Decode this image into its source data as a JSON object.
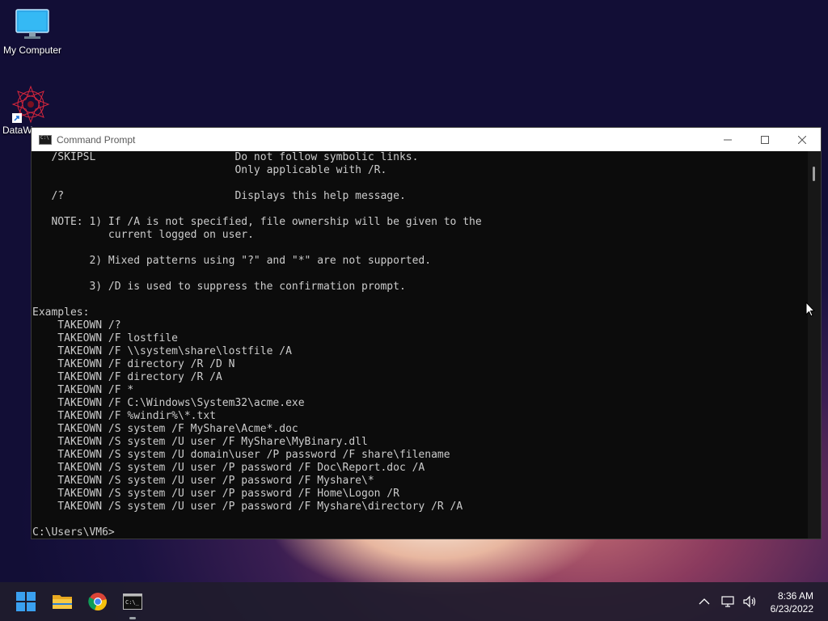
{
  "desktop": {
    "icons": [
      {
        "label": "My Computer"
      },
      {
        "label": "DataW"
      }
    ]
  },
  "window": {
    "title": "Command Prompt",
    "lines": [
      "   /SKIPSL                      Do not follow symbolic links.",
      "                                Only applicable with /R.",
      "",
      "   /?                           Displays this help message.",
      "",
      "   NOTE: 1) If /A is not specified, file ownership will be given to the",
      "            current logged on user.",
      "",
      "         2) Mixed patterns using \"?\" and \"*\" are not supported.",
      "",
      "         3) /D is used to suppress the confirmation prompt.",
      "",
      "Examples:",
      "    TAKEOWN /?",
      "    TAKEOWN /F lostfile",
      "    TAKEOWN /F \\\\system\\share\\lostfile /A",
      "    TAKEOWN /F directory /R /D N",
      "    TAKEOWN /F directory /R /A",
      "    TAKEOWN /F *",
      "    TAKEOWN /F C:\\Windows\\System32\\acme.exe",
      "    TAKEOWN /F %windir%\\*.txt",
      "    TAKEOWN /S system /F MyShare\\Acme*.doc",
      "    TAKEOWN /S system /U user /F MyShare\\MyBinary.dll",
      "    TAKEOWN /S system /U domain\\user /P password /F share\\filename",
      "    TAKEOWN /S system /U user /P password /F Doc\\Report.doc /A",
      "    TAKEOWN /S system /U user /P password /F Myshare\\*",
      "    TAKEOWN /S system /U user /P password /F Home\\Logon /R",
      "    TAKEOWN /S system /U user /P password /F Myshare\\directory /R /A",
      "",
      "C:\\Users\\VM6>"
    ]
  },
  "taskbar": {
    "apps": [
      "start-icon",
      "file-explorer-icon",
      "chrome-icon",
      "command-prompt-icon"
    ],
    "clock": {
      "time": "8:36 AM",
      "date": "6/23/2022"
    }
  }
}
